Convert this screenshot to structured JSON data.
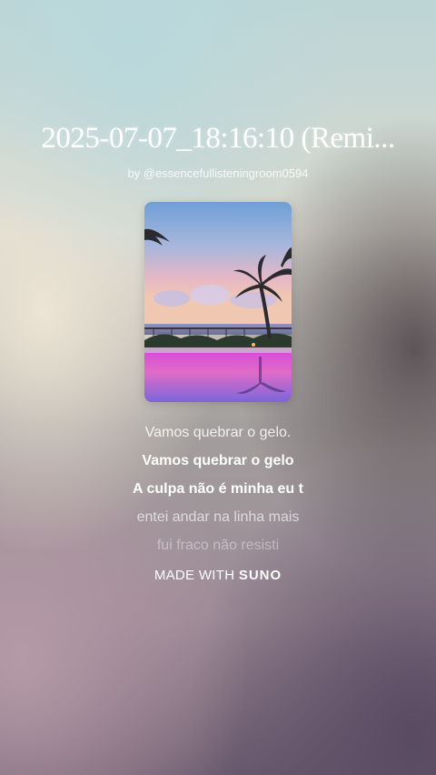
{
  "song": {
    "title": "2025-07-07_18:16:10 (Remi...",
    "byline": "by @essencefullisteningroom0594"
  },
  "cover": {
    "image_description": "tropical sunset with palm trees, ocean and pink reflecting pool"
  },
  "lyrics": {
    "lines": [
      "Vamos quebrar o gelo.",
      "Vamos quebrar o gelo",
      "A culpa não é minha eu t",
      "entei andar na linha mais",
      "fui fraco não resisti"
    ]
  },
  "watermark": {
    "prefix": "MADE WITH",
    "brand": "SUNO"
  }
}
